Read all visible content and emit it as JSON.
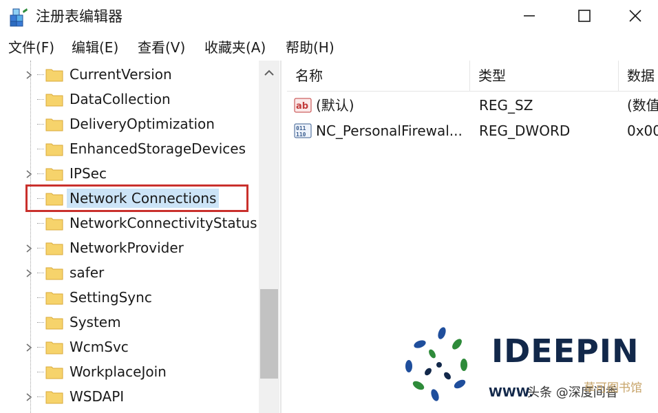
{
  "window": {
    "title": "注册表编辑器",
    "controls": {
      "minimize": "minimize",
      "maximize": "maximize",
      "close": "close"
    }
  },
  "menu": {
    "items": [
      {
        "label": "文件(F)"
      },
      {
        "label": "编辑(E)"
      },
      {
        "label": "查看(V)"
      },
      {
        "label": "收藏夹(A)"
      },
      {
        "label": "帮助(H)"
      }
    ]
  },
  "tree": {
    "items": [
      {
        "label": "CurrentVersion",
        "expandable": true
      },
      {
        "label": "DataCollection",
        "expandable": false
      },
      {
        "label": "DeliveryOptimization",
        "expandable": false
      },
      {
        "label": "EnhancedStorageDevices",
        "expandable": false
      },
      {
        "label": "IPSec",
        "expandable": true
      },
      {
        "label": "Network Connections",
        "expandable": false,
        "selected": true
      },
      {
        "label": "NetworkConnectivityStatus",
        "expandable": false
      },
      {
        "label": "NetworkProvider",
        "expandable": true
      },
      {
        "label": "safer",
        "expandable": true
      },
      {
        "label": "SettingSync",
        "expandable": false
      },
      {
        "label": "System",
        "expandable": false
      },
      {
        "label": "WcmSvc",
        "expandable": true
      },
      {
        "label": "WorkplaceJoin",
        "expandable": false
      },
      {
        "label": "WSDAPI",
        "expandable": true
      }
    ]
  },
  "list": {
    "columns": [
      {
        "label": "名称"
      },
      {
        "label": "类型"
      },
      {
        "label": "数据"
      }
    ],
    "rows": [
      {
        "icon": "string-value-icon",
        "name": "(默认)",
        "type": "REG_SZ",
        "data": "(数值"
      },
      {
        "icon": "binary-value-icon",
        "name": "NC_PersonalFirewal...",
        "type": "REG_DWORD",
        "data": "0x00"
      }
    ]
  },
  "watermark": {
    "logo_text": "IDEEPIN",
    "url_text": "WWW.",
    "overlay_text": "头条 @深度间香",
    "source_text": "草可图书馆",
    "colors": {
      "blue": "#1f4e9c",
      "green": "#2e8b3a",
      "navy": "#12284a"
    }
  },
  "colors": {
    "selection": "#cce4f7",
    "highlight_box": "#c9302c",
    "folder": "#f6d36b",
    "folder_edge": "#d9a93a"
  }
}
